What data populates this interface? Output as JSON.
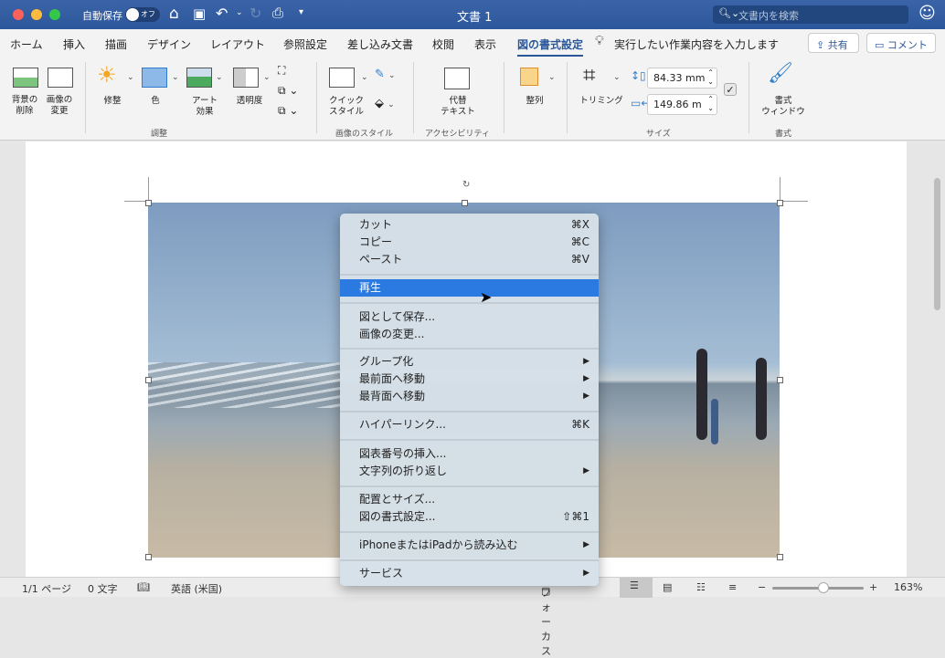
{
  "titlebar": {
    "title": "文書 1",
    "autosave_label": "自動保存",
    "autosave_state": "オフ",
    "search_placeholder": "文書内を検索"
  },
  "tabs": [
    {
      "label": "ホーム"
    },
    {
      "label": "挿入"
    },
    {
      "label": "描画"
    },
    {
      "label": "デザイン"
    },
    {
      "label": "レイアウト"
    },
    {
      "label": "参照設定"
    },
    {
      "label": "差し込み文書"
    },
    {
      "label": "校閲"
    },
    {
      "label": "表示"
    },
    {
      "label": "図の書式設定",
      "active": true
    }
  ],
  "tell_me": "実行したい作業内容を入力します",
  "share_label": "共有",
  "comment_label": "コメント",
  "ribbon": {
    "remove_bg": "背景の\n削除",
    "change_pic": "画像の\n変更",
    "corrections": "修整",
    "color": "色",
    "artistic": "アート\n効果",
    "transparency": "透明度",
    "group_adjust": "調整",
    "quick_styles": "クイック\nスタイル",
    "group_styles": "画像のスタイル",
    "alt_text": "代替\nテキスト",
    "group_access": "アクセシビリティ",
    "arrange": "整列",
    "crop": "トリミング",
    "height": "84.33 mm",
    "width": "149.86 m",
    "group_size": "サイズ",
    "format_pane": "書式\nウィンドウ",
    "group_format": "書式"
  },
  "context_menu": [
    {
      "label": "カット",
      "shortcut": "⌘X"
    },
    {
      "label": "コピー",
      "shortcut": "⌘C"
    },
    {
      "label": "ペースト",
      "shortcut": "⌘V"
    },
    {
      "label": "再生",
      "highlighted": true
    },
    {
      "label": "図として保存..."
    },
    {
      "label": "画像の変更..."
    },
    {
      "label": "グループ化",
      "submenu": "▶"
    },
    {
      "label": "最前面へ移動",
      "submenu": "▶"
    },
    {
      "label": "最背面へ移動",
      "submenu": "▶"
    },
    {
      "label": "ハイパーリンク...",
      "shortcut": "⌘K"
    },
    {
      "label": "図表番号の挿入..."
    },
    {
      "label": "文字列の折り返し",
      "submenu": "▶"
    },
    {
      "label": "配置とサイズ..."
    },
    {
      "label": "図の書式設定...",
      "shortcut": "⇧⌘1"
    },
    {
      "label": "iPhoneまたはiPadから読み込む",
      "submenu": "▶"
    },
    {
      "label": "サービス",
      "submenu": "▶"
    }
  ],
  "status": {
    "page": "1/1 ページ",
    "words": "0 文字",
    "language": "英語 (米国)",
    "focus": "フォーカス",
    "zoom": "163%",
    "zoom_level_percent": 163
  },
  "colors": {
    "titlebar": "#2d579c",
    "accent": "#2a7ae2"
  }
}
